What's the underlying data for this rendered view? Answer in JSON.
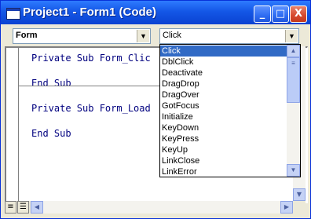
{
  "window": {
    "title": "Project1 - Form1 (Code)"
  },
  "title_buttons": {
    "minimize": "_",
    "maximize": "□",
    "close": "X"
  },
  "object_combo": {
    "value": "Form"
  },
  "proc_combo": {
    "value": "Click"
  },
  "code_lines": [
    "Private Sub Form_Clic",
    "End Sub",
    "Private Sub Form_Load",
    "End Sub"
  ],
  "dropdown": {
    "items": [
      "Click",
      "DblClick",
      "Deactivate",
      "DragDrop",
      "DragOver",
      "GotFocus",
      "Initialize",
      "KeyDown",
      "KeyPress",
      "KeyUp",
      "LinkClose",
      "LinkError"
    ],
    "selected_index": 0
  },
  "colors": {
    "title_blue": "#0A42D2",
    "code_blue": "#00007F",
    "selection": "#316AC5"
  }
}
